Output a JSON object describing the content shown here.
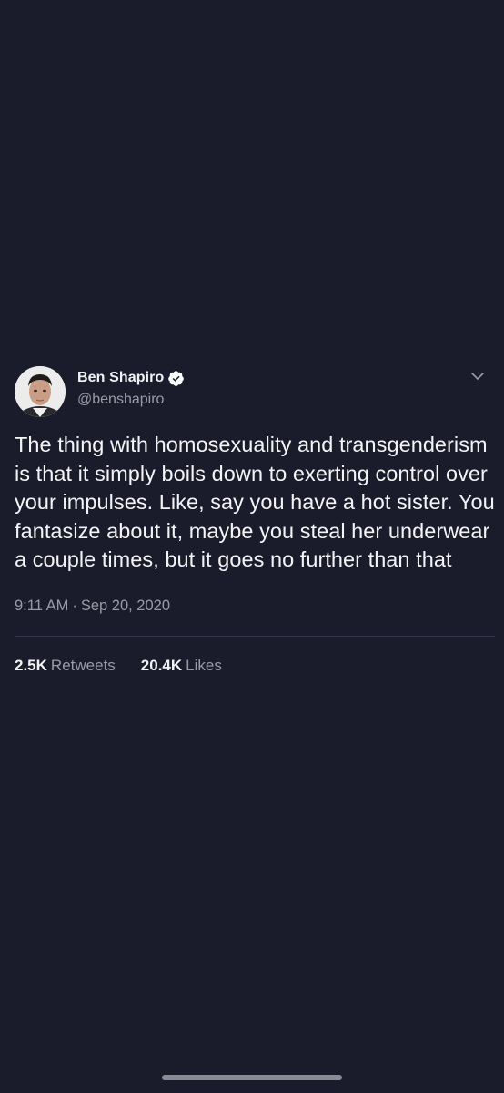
{
  "tweet": {
    "display_name": "Ben Shapiro",
    "handle": "@benshapiro",
    "verified": true,
    "text": "The thing with homosexuality and transgenderism is that it simply boils down to exerting control over your impulses. Like, say you have a hot sister. You fantasize about it, maybe you steal her underwear a couple times, but it goes no further than that",
    "time": "9:11 AM",
    "date": "Sep 20, 2020",
    "separator": "·",
    "retweets_count": "2.5K",
    "retweets_label": "Retweets",
    "likes_count": "20.4K",
    "likes_label": "Likes"
  },
  "colors": {
    "background": "#1b1c2b",
    "text_primary": "#f2f2f4",
    "text_secondary": "#9a9aa6",
    "verified_badge": "#ffffff"
  },
  "icons": {
    "avatar": "profile-photo",
    "verified": "verified-badge-icon",
    "menu": "chevron-down-icon"
  }
}
